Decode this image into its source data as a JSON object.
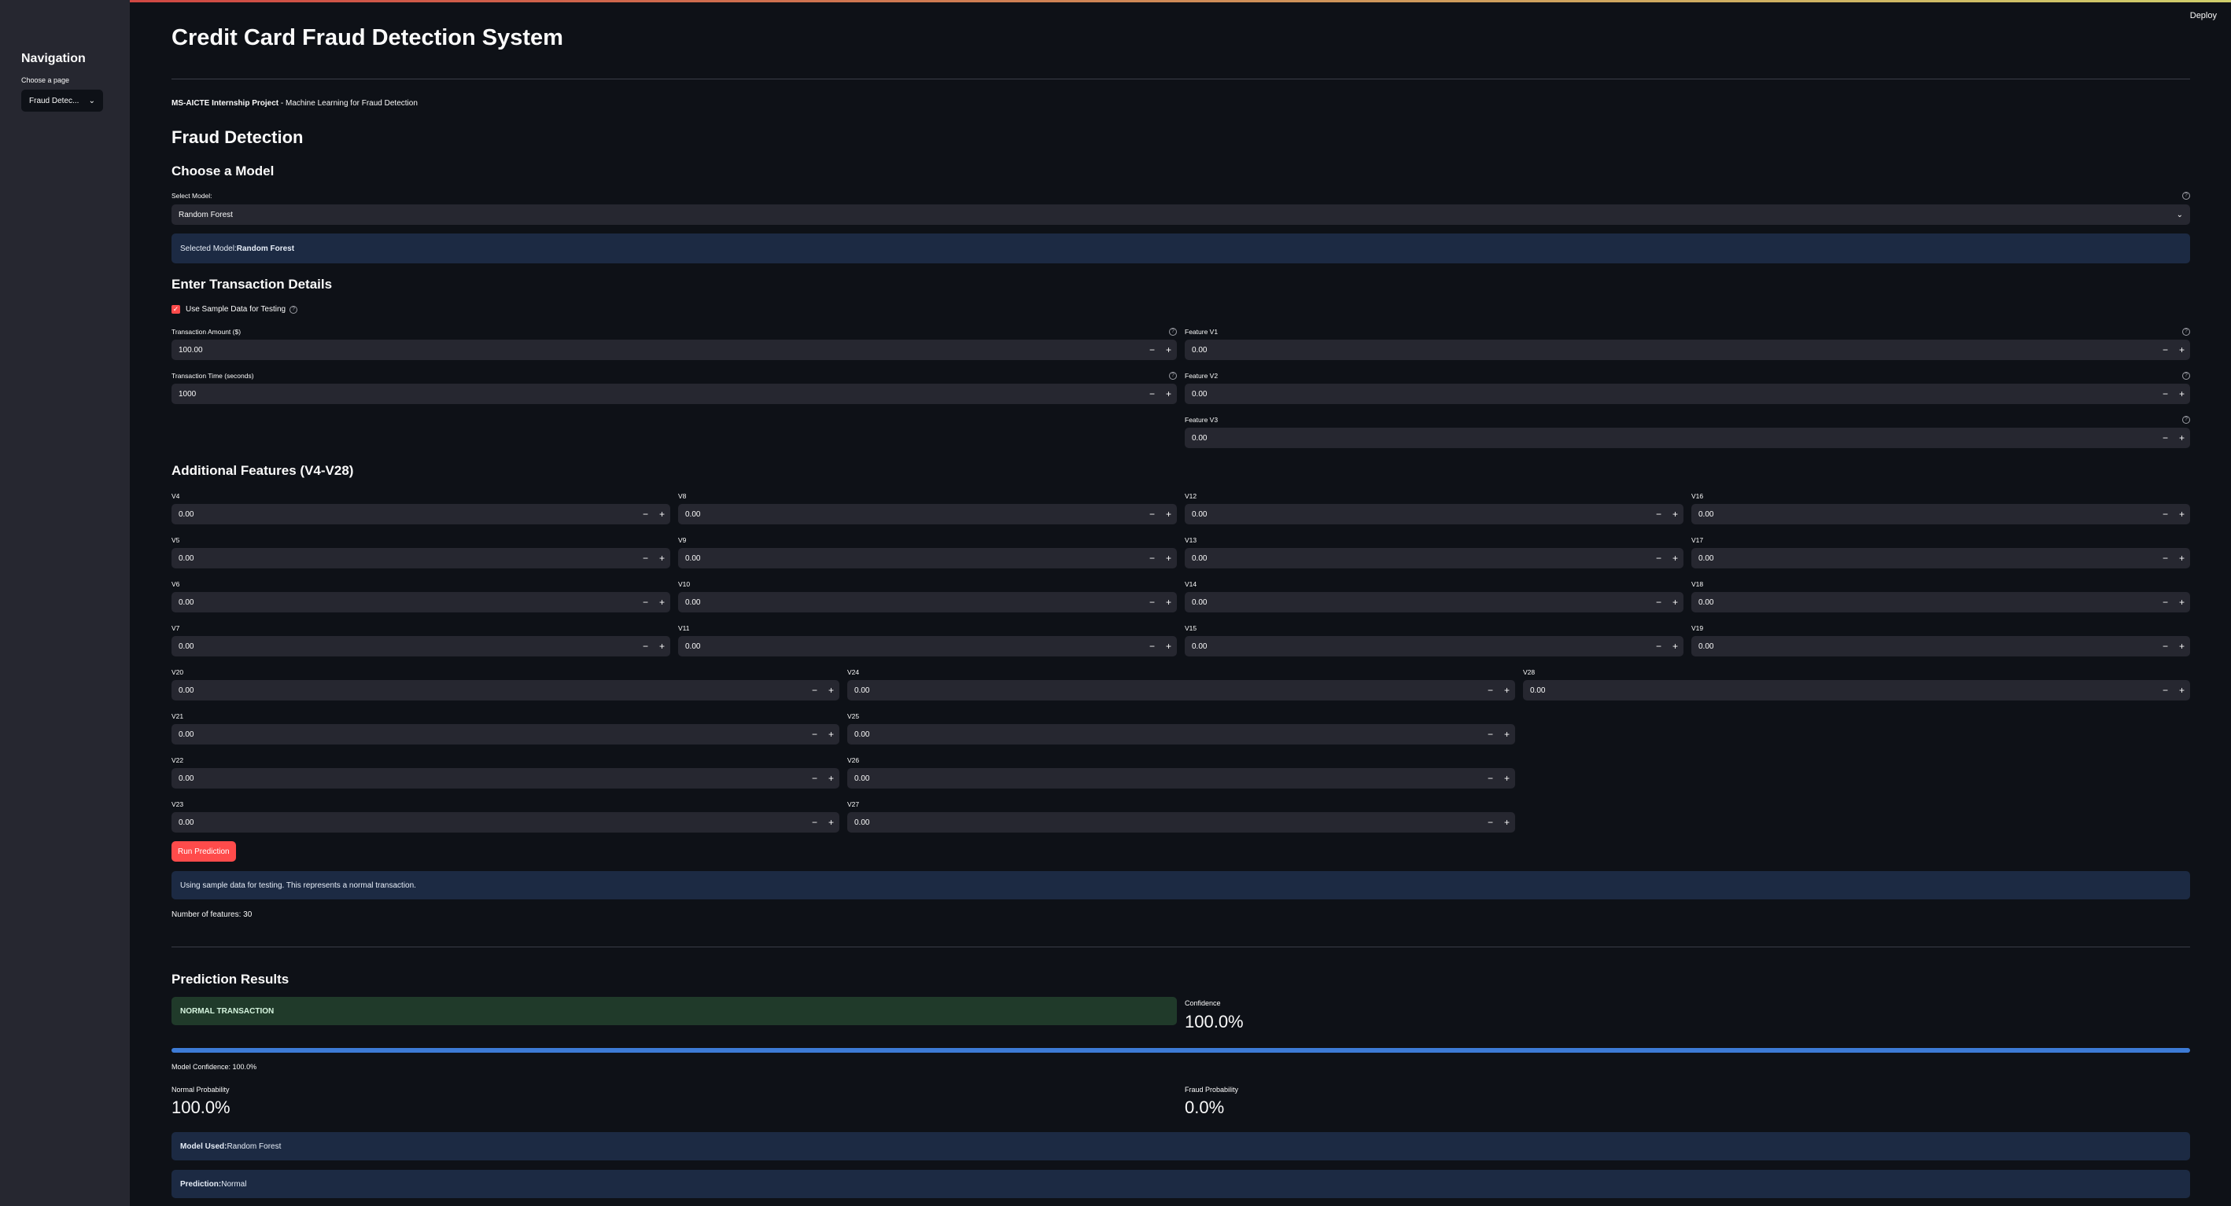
{
  "deploy_label": "Deploy",
  "sidebar": {
    "title": "Navigation",
    "choose_label": "Choose a page",
    "selected_page": "Fraud Detec..."
  },
  "page": {
    "title": "Credit Card Fraud Detection System",
    "subtitle_bold": "MS-AICTE Internship Project",
    "subtitle_rest": " - Machine Learning for Fraud Detection",
    "section_title": "Fraud Detection"
  },
  "model": {
    "heading": "Choose a Model",
    "select_label": "Select Model:",
    "selected": "Random Forest",
    "info_prefix": "Selected Model: ",
    "info_value": "Random Forest"
  },
  "transaction": {
    "heading": "Enter Transaction Details",
    "sample_checkbox": "Use Sample Data for Testing",
    "amount_label": "Transaction Amount ($)",
    "amount_value": "100.00",
    "time_label": "Transaction Time (seconds)",
    "time_value": "1000",
    "v1_label": "Feature V1",
    "v1_value": "0.00",
    "v2_label": "Feature V2",
    "v2_value": "0.00",
    "v3_label": "Feature V3",
    "v3_value": "0.00"
  },
  "additional": {
    "heading": "Additional Features (V4-V28)",
    "features": {
      "V4": "0.00",
      "V5": "0.00",
      "V6": "0.00",
      "V7": "0.00",
      "V8": "0.00",
      "V9": "0.00",
      "V10": "0.00",
      "V11": "0.00",
      "V12": "0.00",
      "V13": "0.00",
      "V14": "0.00",
      "V15": "0.00",
      "V16": "0.00",
      "V17": "0.00",
      "V18": "0.00",
      "V19": "0.00",
      "V20": "0.00",
      "V21": "0.00",
      "V22": "0.00",
      "V23": "0.00",
      "V24": "0.00",
      "V25": "0.00",
      "V26": "0.00",
      "V27": "0.00",
      "V28": "0.00"
    }
  },
  "stepper": {
    "minus": "−",
    "plus": "+"
  },
  "run_button": "Run Prediction",
  "sample_info": "Using sample data for testing. This represents a normal transaction.",
  "num_features": "Number of features: 30",
  "results": {
    "heading": "Prediction Results",
    "status": "NORMAL TRANSACTION",
    "confidence_label": "Confidence",
    "confidence_value": "100.0%",
    "progress_fraction": 1.0,
    "model_confidence": "Model Confidence: 100.0%",
    "normal_label": "Normal Probability",
    "normal_value": "100.0%",
    "fraud_label": "Fraud Probability",
    "fraud_value": "0.0%",
    "model_used_prefix": "Model Used: ",
    "model_used_value": "Random Forest",
    "prediction_prefix": "Prediction: ",
    "prediction_value": "Normal"
  },
  "colors": {
    "accent": "#ff4b4b",
    "info_bg": "#1c2a43",
    "success_bg": "#203a2a",
    "progress": "#3d7bd6"
  }
}
